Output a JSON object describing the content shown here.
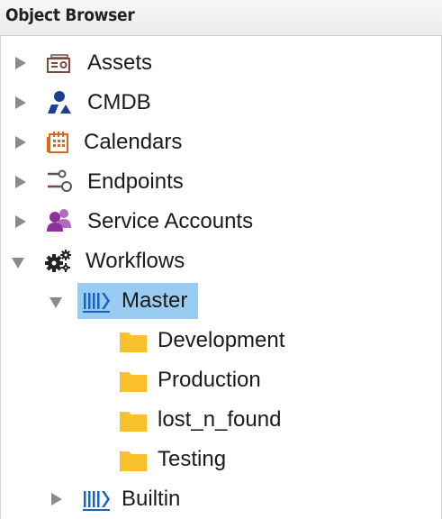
{
  "panel": {
    "title": "Object Browser"
  },
  "tree": {
    "items": [
      {
        "label": "Assets",
        "icon": "assets-icon",
        "expanded": false
      },
      {
        "label": "CMDB",
        "icon": "cmdb-icon",
        "expanded": false
      },
      {
        "label": "Calendars",
        "icon": "calendar-icon",
        "expanded": false
      },
      {
        "label": "Endpoints",
        "icon": "endpoints-icon",
        "expanded": false
      },
      {
        "label": "Service Accounts",
        "icon": "service-accounts-icon",
        "expanded": false
      },
      {
        "label": "Workflows",
        "icon": "gears-icon",
        "expanded": true,
        "children": [
          {
            "label": "Master",
            "icon": "workflow-icon",
            "expanded": true,
            "selected": true,
            "children": [
              {
                "label": "Development",
                "icon": "folder-icon"
              },
              {
                "label": "Production",
                "icon": "folder-icon"
              },
              {
                "label": "lost_n_found",
                "icon": "folder-icon"
              },
              {
                "label": "Testing",
                "icon": "folder-icon"
              }
            ]
          },
          {
            "label": "Builtin",
            "icon": "workflow-icon",
            "expanded": false
          }
        ]
      }
    ]
  },
  "colors": {
    "selection": "#99ccf3",
    "folder": "#f9c02e",
    "workflow_blue": "#1565c0",
    "cmdb_blue": "#1e3f8f",
    "calendar_orange": "#e0651a",
    "service_purple": "#8e2f9a",
    "assets_brown": "#7a4a3a"
  }
}
